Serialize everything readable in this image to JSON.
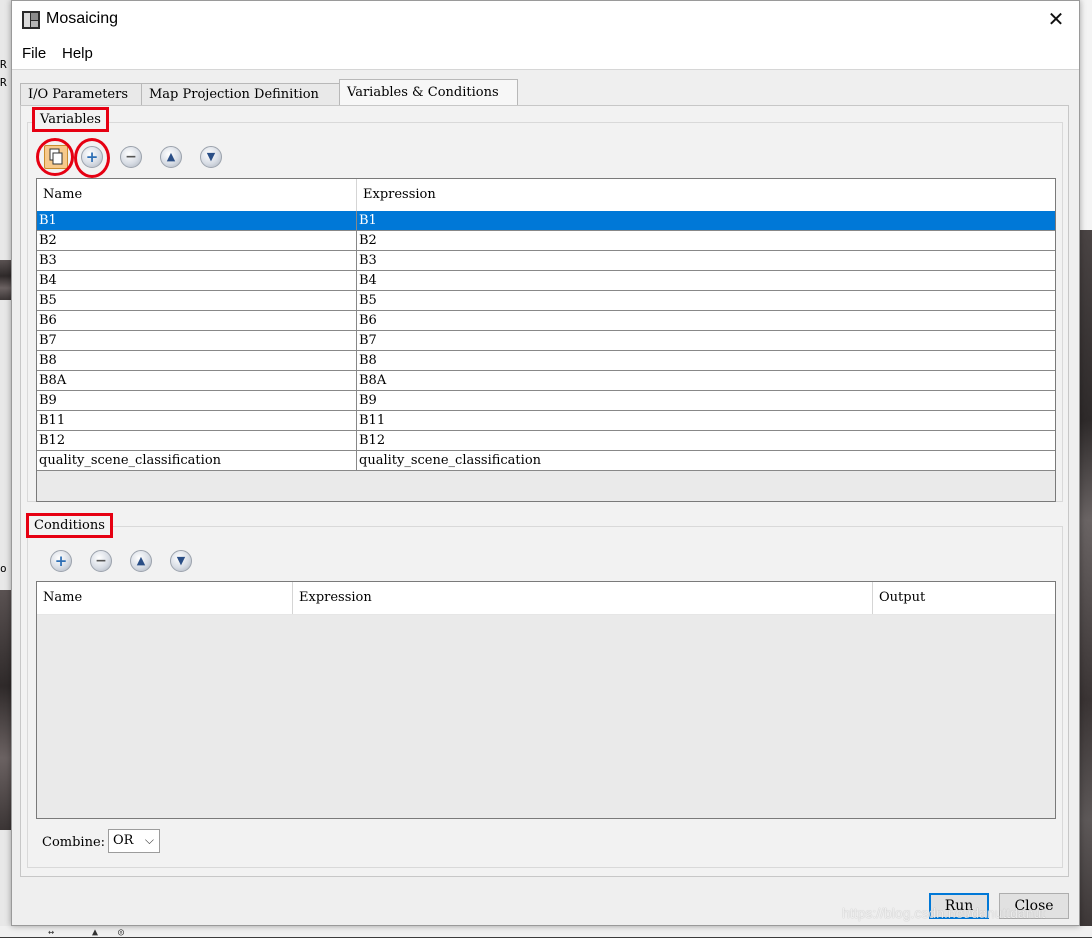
{
  "window": {
    "title": "Mosaicing",
    "close_glyph": "✕"
  },
  "menu": [
    "File",
    "Help"
  ],
  "tabs": [
    {
      "label": "I/O Parameters"
    },
    {
      "label": "Map Projection Definition"
    },
    {
      "label": "Variables & Conditions",
      "active": true
    }
  ],
  "variables": {
    "group_title": "Variables",
    "toolbar": [
      "copy-bands-icon",
      "add-icon",
      "remove-icon",
      "move-up-icon",
      "move-down-icon"
    ],
    "columns": [
      "Name",
      "Expression"
    ],
    "rows": [
      {
        "name": "B1",
        "expression": "B1",
        "selected": true
      },
      {
        "name": "B2",
        "expression": "B2"
      },
      {
        "name": "B3",
        "expression": "B3"
      },
      {
        "name": "B4",
        "expression": "B4"
      },
      {
        "name": "B5",
        "expression": "B5"
      },
      {
        "name": "B6",
        "expression": "B6"
      },
      {
        "name": "B7",
        "expression": "B7"
      },
      {
        "name": "B8",
        "expression": "B8"
      },
      {
        "name": "B8A",
        "expression": "B8A"
      },
      {
        "name": "B9",
        "expression": "B9"
      },
      {
        "name": "B11",
        "expression": "B11"
      },
      {
        "name": "B12",
        "expression": "B12"
      },
      {
        "name": "quality_scene_classification",
        "expression": "quality_scene_classification"
      }
    ]
  },
  "conditions": {
    "group_title": "Conditions",
    "toolbar": [
      "add-icon",
      "remove-icon",
      "move-up-icon",
      "move-down-icon"
    ],
    "columns": [
      "Name",
      "Expression",
      "Output"
    ],
    "rows": [],
    "combine_label": "Combine:",
    "combine_value": "OR"
  },
  "buttons": {
    "run": "Run",
    "close": "Close"
  },
  "watermark": "https://blog.csdn.net/danuttdanut",
  "colors": {
    "selection": "#0078d7",
    "annotation": "#e60012",
    "default_button_border": "#0078d7"
  }
}
